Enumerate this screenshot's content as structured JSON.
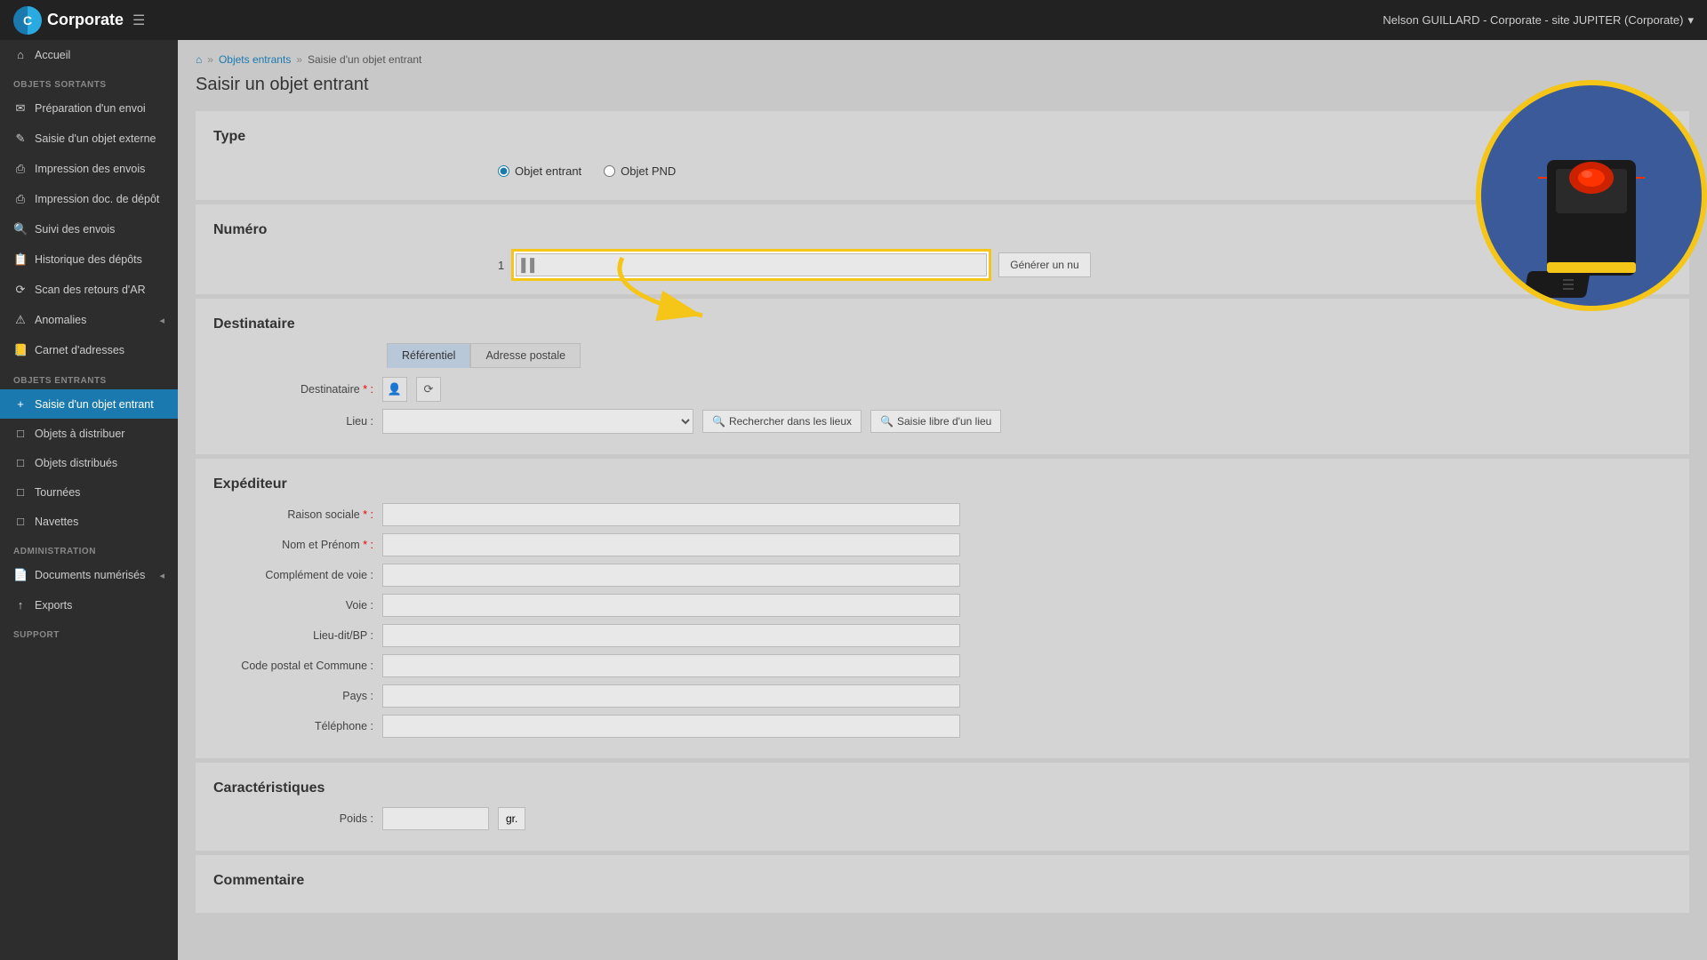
{
  "topnav": {
    "brand": "Corporate",
    "logo_letter": "C",
    "user_info": "Nelson GUILLARD - Corporate - site JUPITER (Corporate)",
    "dropdown_icon": "▾"
  },
  "sidebar": {
    "sections": [
      {
        "label": "",
        "items": [
          {
            "id": "accueil",
            "icon": "⌂",
            "label": "Accueil",
            "active": false
          }
        ]
      },
      {
        "label": "OBJETS SORTANTS",
        "items": [
          {
            "id": "preparation",
            "icon": "✉",
            "label": "Préparation d'un envoi",
            "active": false
          },
          {
            "id": "saisie-externe",
            "icon": "✎",
            "label": "Saisie d'un objet externe",
            "active": false
          },
          {
            "id": "impression-envois",
            "icon": "⎙",
            "label": "Impression des envois",
            "active": false
          },
          {
            "id": "impression-depot",
            "icon": "⎙",
            "label": "Impression doc. de dépôt",
            "active": false
          },
          {
            "id": "suivi",
            "icon": "🔍",
            "label": "Suivi des envois",
            "active": false
          },
          {
            "id": "historique",
            "icon": "📋",
            "label": "Historique des dépôts",
            "active": false
          },
          {
            "id": "scan-retours",
            "icon": "⟳",
            "label": "Scan des retours d'AR",
            "active": false
          },
          {
            "id": "anomalies",
            "icon": "⚠",
            "label": "Anomalies",
            "active": false
          },
          {
            "id": "carnet",
            "icon": "📒",
            "label": "Carnet d'adresses",
            "active": false
          }
        ]
      },
      {
        "label": "OBJETS ENTRANTS",
        "items": [
          {
            "id": "saisie-entrant",
            "icon": "+",
            "label": "Saisie d'un objet entrant",
            "active": true
          },
          {
            "id": "objets-distribuer",
            "icon": "□",
            "label": "Objets à distribuer",
            "active": false
          },
          {
            "id": "objets-distribues",
            "icon": "□",
            "label": "Objets distribués",
            "active": false
          },
          {
            "id": "tournees",
            "icon": "□",
            "label": "Tournées",
            "active": false
          },
          {
            "id": "navettes",
            "icon": "□",
            "label": "Navettes",
            "active": false
          }
        ]
      },
      {
        "label": "ADMINISTRATION",
        "items": [
          {
            "id": "docs-num",
            "icon": "📄",
            "label": "Documents numérisés",
            "active": false
          },
          {
            "id": "exports",
            "icon": "↑",
            "label": "Exports",
            "active": false
          }
        ]
      },
      {
        "label": "SUPPORT",
        "items": []
      }
    ]
  },
  "breadcrumb": {
    "home_icon": "⌂",
    "items": [
      "Objets entrants",
      "Saisie d'un objet entrant"
    ]
  },
  "page": {
    "title": "Saisir un objet entrant"
  },
  "form": {
    "type_section": "Type",
    "type_option1": "Objet entrant",
    "type_option2": "Objet PND",
    "numero_section": "Numéro",
    "numero_prefix": "1",
    "numero_placeholder": "",
    "generer_label": "Générer un nu",
    "destinataire_section": "Destinataire",
    "tab_referentiel": "Référentiel",
    "tab_adresse": "Adresse postale",
    "destinataire_label": "Destinataire",
    "lieu_label": "Lieu :",
    "rechercher_lieux": "Rechercher dans les lieux",
    "saisie_libre": "Saisie libre d'un lieu",
    "expediteur_section": "Expéditeur",
    "raison_sociale_label": "Raison sociale",
    "nom_prenom_label": "Nom et Prénom",
    "complement_label": "Complément de voie :",
    "voie_label": "Voie :",
    "lieu_dit_label": "Lieu-dit/BP :",
    "code_postal_label": "Code postal et Commune :",
    "pays_label": "Pays :",
    "telephone_label": "Téléphone :",
    "caracteristiques_section": "Caractéristiques",
    "poids_label": "Poids :",
    "poids_unit": "gr.",
    "commentaire_section": "Commentaire"
  },
  "icons": {
    "person": "👤",
    "refresh": "⟳",
    "search": "🔍",
    "barcode": "▌▌",
    "dropdown": "▾"
  }
}
